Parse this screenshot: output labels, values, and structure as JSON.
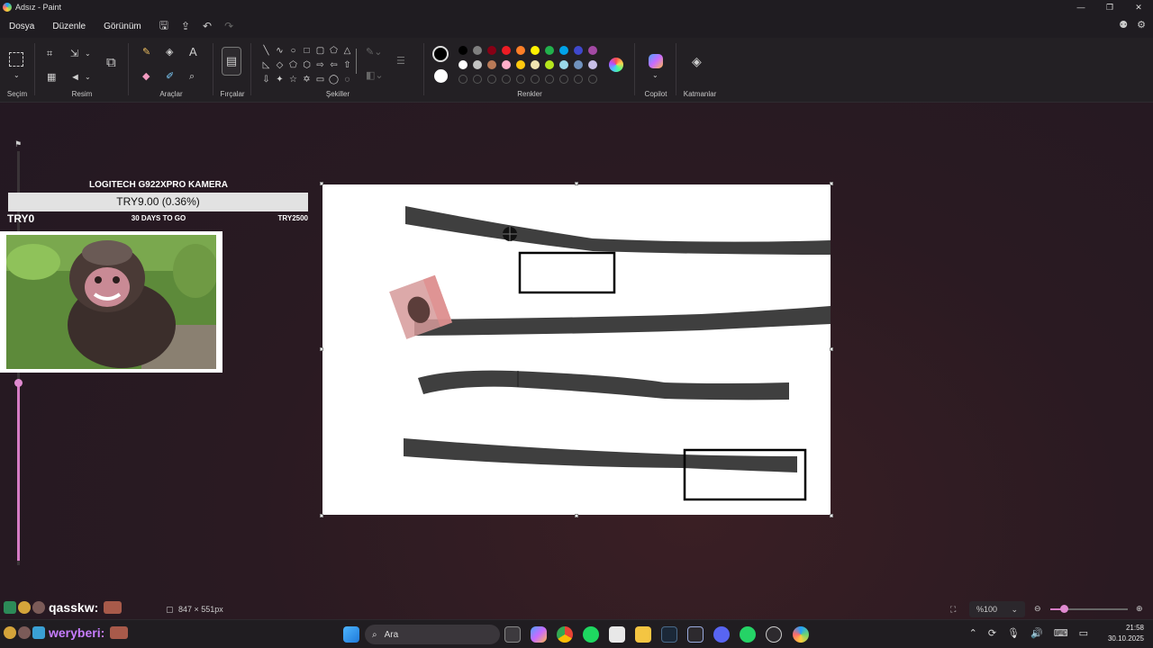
{
  "window": {
    "title": "Adsız - Paint",
    "controls": [
      "—",
      "❐",
      "✕"
    ]
  },
  "menu": {
    "items": [
      "Dosya",
      "Düzenle",
      "Görünüm"
    ]
  },
  "ribbon": {
    "groups": {
      "selection": "Seçim",
      "image": "Resim",
      "tools": "Araçlar",
      "brushes": "Fırçalar",
      "shapes": "Şekiller",
      "colors": "Renkler",
      "copilot": "Copilot",
      "layers": "Katmanlar"
    },
    "palette_row1": [
      "#000000",
      "#7f7f7f",
      "#880015",
      "#ed1c24",
      "#ff7f27",
      "#fff200",
      "#22b14c",
      "#00a2e8",
      "#3f48cc",
      "#a349a4"
    ],
    "palette_row2": [
      "#ffffff",
      "#c3c3c3",
      "#b97a57",
      "#ffaec9",
      "#ffc90e",
      "#efe4b0",
      "#b5e61d",
      "#99d9ea",
      "#7092be",
      "#c8bfe7"
    ]
  },
  "overlay": {
    "goal": {
      "title": "LOGITECH G922XPRO KAMERA",
      "amount": "TRY9.00 (0.36%)",
      "start": "TRY0",
      "days": "30 DAYS TO GO",
      "target": "TRY2500"
    },
    "chat": [
      {
        "user": "qasskw:",
        "color": "#ffffff"
      },
      {
        "user": "weryberi:",
        "color": "#c77dff"
      }
    ]
  },
  "status": {
    "canvas_size": "847 × 551px",
    "zoom": "%100"
  },
  "taskbar": {
    "search_placeholder": "Ara",
    "time": "21:58",
    "date": "30.10.2025"
  }
}
